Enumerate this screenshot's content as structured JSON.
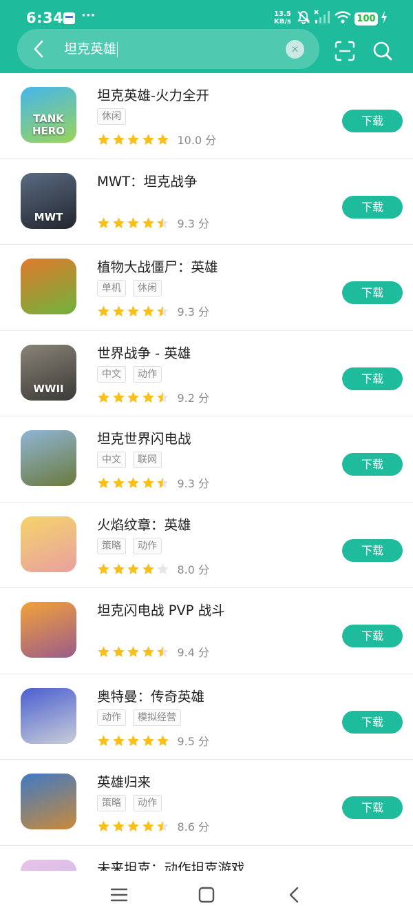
{
  "status_bar": {
    "time": "6:34",
    "notif_dots": "···",
    "net_speed_value": "13.5",
    "net_speed_unit": "KB/s",
    "battery": "100",
    "icons": [
      "mute-icon",
      "signal-icon",
      "wifi-icon",
      "charging-icon"
    ]
  },
  "search": {
    "query": "坦克英雄",
    "clear_symbol": "×"
  },
  "colors": {
    "accent": "#1ebc9c",
    "star": "#fbbf1a",
    "star_empty": "#e6e6e6"
  },
  "apps": [
    {
      "title": "坦克英雄-火力全开",
      "tags": [
        "休闲"
      ],
      "rating": 5,
      "score": "10.0 分",
      "button": "下载",
      "icon_label": "TANK HERO",
      "icon_colors": [
        "#45b6ea",
        "#9ad45a"
      ]
    },
    {
      "title": "MWT：坦克战争",
      "tags": [],
      "rating": 4.5,
      "score": "9.3 分",
      "button": "下载",
      "icon_label": "MWT",
      "icon_colors": [
        "#5a6b82",
        "#23262e"
      ]
    },
    {
      "title": "植物大战僵尸：英雄",
      "tags": [
        "单机",
        "休闲"
      ],
      "rating": 4.5,
      "score": "9.3 分",
      "button": "下载",
      "icon_label": "",
      "icon_colors": [
        "#e27a2c",
        "#6fb23c"
      ]
    },
    {
      "title": "世界战争 - 英雄",
      "tags": [
        "中文",
        "动作"
      ],
      "rating": 4.5,
      "score": "9.2 分",
      "button": "下载",
      "icon_label": "WWII",
      "icon_colors": [
        "#8a8378",
        "#3b3a36"
      ]
    },
    {
      "title": "坦克世界闪电战",
      "tags": [
        "中文",
        "联网"
      ],
      "rating": 4.5,
      "score": "9.3 分",
      "button": "下载",
      "icon_label": "",
      "icon_colors": [
        "#8fb5d6",
        "#6a7a3c"
      ]
    },
    {
      "title": "火焰纹章：英雄",
      "tags": [
        "策略",
        "动作"
      ],
      "rating": 4,
      "score": "8.0 分",
      "button": "下载",
      "icon_label": "",
      "icon_colors": [
        "#f4d46a",
        "#e9a0a0"
      ]
    },
    {
      "title": "坦克闪电战 PVP 战斗",
      "tags": [],
      "rating": 4.5,
      "score": "9.4 分",
      "button": "下载",
      "icon_label": "",
      "icon_colors": [
        "#f2a23a",
        "#9b5b8a"
      ]
    },
    {
      "title": "奥特曼：传奇英雄",
      "tags": [
        "动作",
        "模拟经营"
      ],
      "rating": 5,
      "score": "9.5 分",
      "button": "下载",
      "icon_label": "",
      "icon_colors": [
        "#4a5fd0",
        "#c9cdd8"
      ]
    },
    {
      "title": "英雄归来",
      "tags": [
        "策略",
        "动作"
      ],
      "rating": 4.5,
      "score": "8.6 分",
      "button": "下载",
      "icon_label": "",
      "icon_colors": [
        "#3f7ac4",
        "#c98a3a"
      ]
    },
    {
      "title": "未来坦克：动作坦克游戏",
      "tags": [],
      "rating": 0,
      "score": "",
      "button": "",
      "icon_label": "",
      "icon_colors": [
        "#e9c3e6",
        "#c4b6f0"
      ]
    }
  ]
}
